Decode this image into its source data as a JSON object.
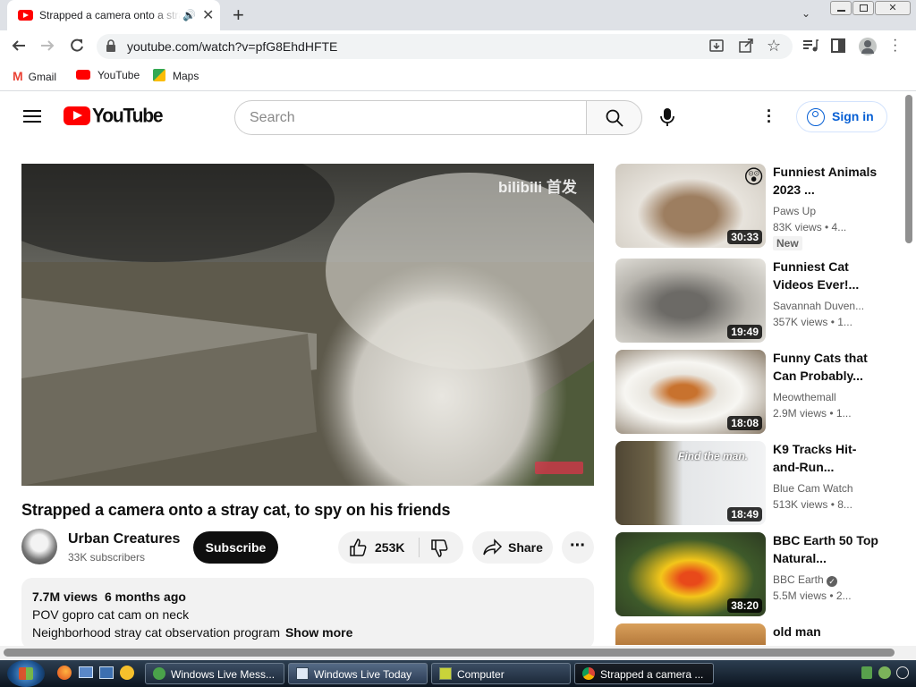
{
  "browser": {
    "tab_title": "Strapped a camera onto a stray cat, to spy on his friends",
    "url": "youtube.com/watch?v=pfG8EhdHFTE",
    "bookmarks": [
      {
        "label": "Gmail",
        "icon": "gmail-icon"
      },
      {
        "label": "YouTube",
        "icon": "youtube-icon"
      },
      {
        "label": "Maps",
        "icon": "maps-icon"
      }
    ]
  },
  "youtube": {
    "logo": "YouTube",
    "search_placeholder": "Search",
    "sign_in": "Sign in",
    "video": {
      "overlay_watermark": "bilibili 首发",
      "title": "Strapped a camera onto a stray cat, to spy on his friends",
      "channel": "Urban Creatures",
      "subscribers": "33K subscribers",
      "subscribe": "Subscribe",
      "likes": "253K",
      "share": "Share",
      "views": "7.7M views",
      "age": "6 months ago",
      "desc_line1": "POV gopro cat cam on neck",
      "desc_line2": "Neighborhood stray cat observation program",
      "show_more": "Show more"
    },
    "recommended": [
      {
        "title": "Funniest Animals 2023 ...",
        "channel": "Paws Up",
        "meta": "83K views  • 4...",
        "badge": "New",
        "duration": "30:33"
      },
      {
        "title": "Funniest Cat Videos Ever!...",
        "channel": "Savannah Duven...",
        "meta": "357K views  • 1...",
        "duration": "19:49"
      },
      {
        "title": "Funny Cats that Can Probably...",
        "channel": "Meowthemall",
        "meta": "2.9M views  • 1...",
        "duration": "18:08"
      },
      {
        "title": "K9 Tracks Hit-and-Run...",
        "channel": "Blue Cam Watch",
        "meta": "513K views  • 8...",
        "duration": "18:49",
        "thumb_text": "Find the man."
      },
      {
        "title": "BBC Earth 50 Top Natural...",
        "channel": "BBC Earth",
        "meta": "5.5M views  • 2...",
        "duration": "38:20",
        "verified": true
      },
      {
        "title": "old man",
        "channel": "",
        "meta": ""
      }
    ]
  },
  "taskbar": {
    "items": [
      {
        "label": "Windows Live Mess..."
      },
      {
        "label": "Windows Live Today"
      },
      {
        "label": "Computer"
      },
      {
        "label": "Strapped a camera ..."
      }
    ]
  },
  "colors": {
    "accent": "#065fd4",
    "youtube_red": "#ff0000",
    "subscribe_bg": "#0f0f0f"
  }
}
